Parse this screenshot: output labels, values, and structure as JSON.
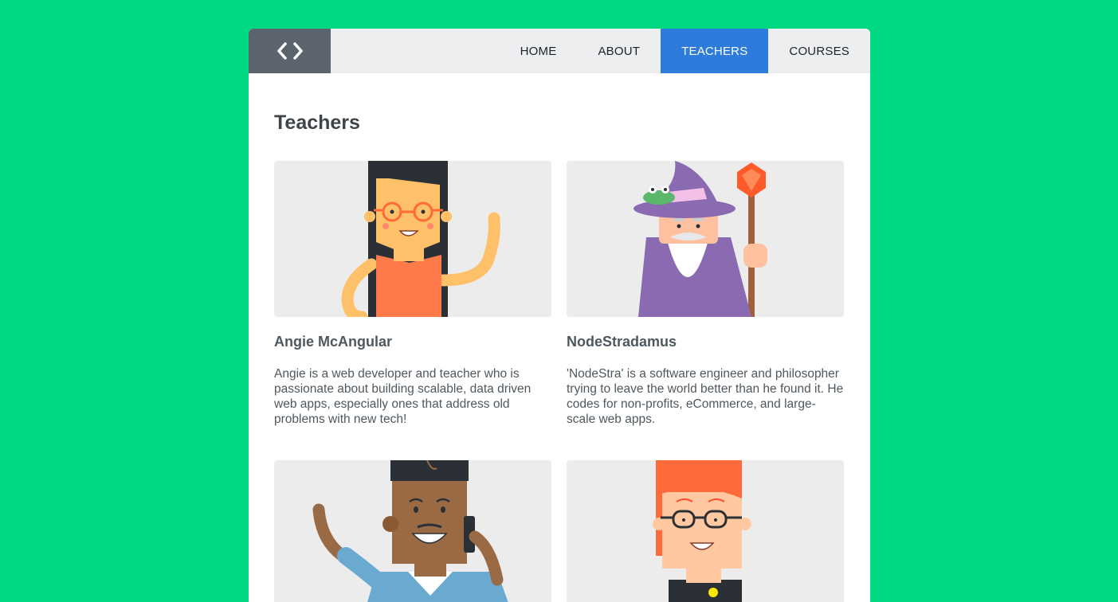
{
  "nav": {
    "logo_icon": "code-brackets-icon",
    "links": [
      {
        "label": "HOME",
        "active": false
      },
      {
        "label": "ABOUT",
        "active": false
      },
      {
        "label": "TEACHERS",
        "active": true
      },
      {
        "label": "COURSES",
        "active": false
      }
    ]
  },
  "page": {
    "title": "Teachers"
  },
  "teachers": [
    {
      "name": "Angie McAngular",
      "bio": "Angie is a web developer and teacher who is passionate about building scalable, data driven web apps, especially ones that address old problems with new tech!",
      "avatar": "angie-illustration"
    },
    {
      "name": "NodeStradamus",
      "bio": "'NodeStra' is a software engineer and philosopher trying to leave the world better than he found it. He codes for non-profits, eCommerce, and large-scale web apps.",
      "avatar": "wizard-illustration"
    },
    {
      "name": "",
      "bio": "",
      "avatar": "man-on-phone-illustration"
    },
    {
      "name": "",
      "bio": "",
      "avatar": "red-hair-glasses-illustration"
    }
  ],
  "colors": {
    "background": "#00d882",
    "nav_active": "#2d7bdb",
    "logo_bg": "#5b646d",
    "card_bg": "#ececec"
  }
}
